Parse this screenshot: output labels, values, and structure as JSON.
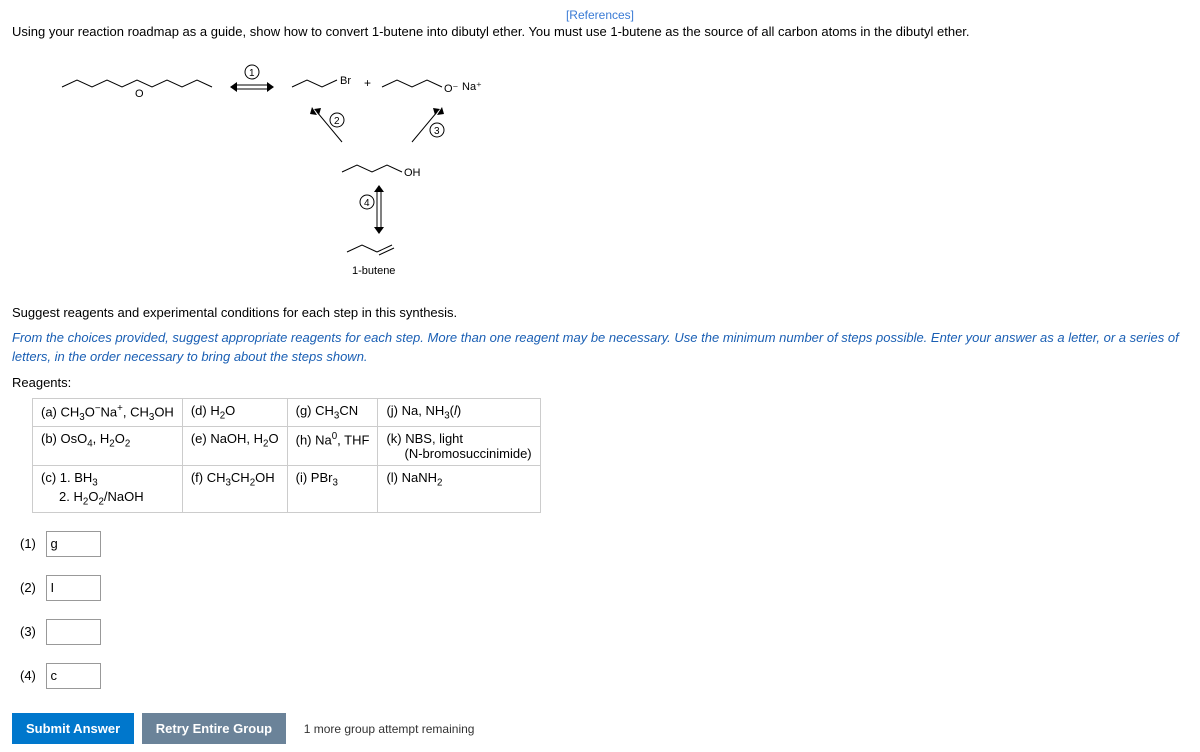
{
  "references_link": "[References]",
  "question": "Using your reaction roadmap as a guide, show how to convert 1-butene into dibutyl ether. You must use 1-butene as the source of all carbon atoms in the dibutyl ether.",
  "scheme": {
    "step1": "①",
    "step2": "②",
    "step3": "③",
    "step4": "④",
    "label_br": "Br",
    "plus": "+",
    "label_o": "O",
    "label_na": "Na⁺",
    "label_oh": "OH",
    "label_bottom": "1-butene"
  },
  "suggest_text": "Suggest reagents and experimental conditions for each step in this synthesis.",
  "instructions": "From the choices provided, suggest appropriate reagents for each step. More than one reagent may be necessary. Use the minimum number of steps possible. Enter your answer as a letter, or a series of letters, in the order necessary to bring about the steps shown.",
  "reagents_label": "Reagents:",
  "reagents": {
    "a": "(a) CH₃O⁻Na⁺, CH₃OH",
    "b": "(b) OsO₄, H₂O₂",
    "c": "(c) 1. BH₃\n     2. H₂O₂/NaOH",
    "d": "(d) H₂O",
    "e": "(e) NaOH, H₂O",
    "f": "(f) CH₃CH₂OH",
    "g": "(g) CH₃CN",
    "h": "(h) Na⁰, THF",
    "i": "(i) PBr₃",
    "j": "(j) Na, NH₃(l)",
    "k": "(k) NBS, light\n     (N-bromosuccinimide)",
    "l": "(l) NaNH₂"
  },
  "answers": {
    "row1": {
      "label": "(1)",
      "value": "g"
    },
    "row2": {
      "label": "(2)",
      "value": "I"
    },
    "row3": {
      "label": "(3)",
      "value": ""
    },
    "row4": {
      "label": "(4)",
      "value": "c"
    }
  },
  "buttons": {
    "submit": "Submit Answer",
    "retry": "Retry Entire Group"
  },
  "attempts": "1 more group attempt remaining"
}
